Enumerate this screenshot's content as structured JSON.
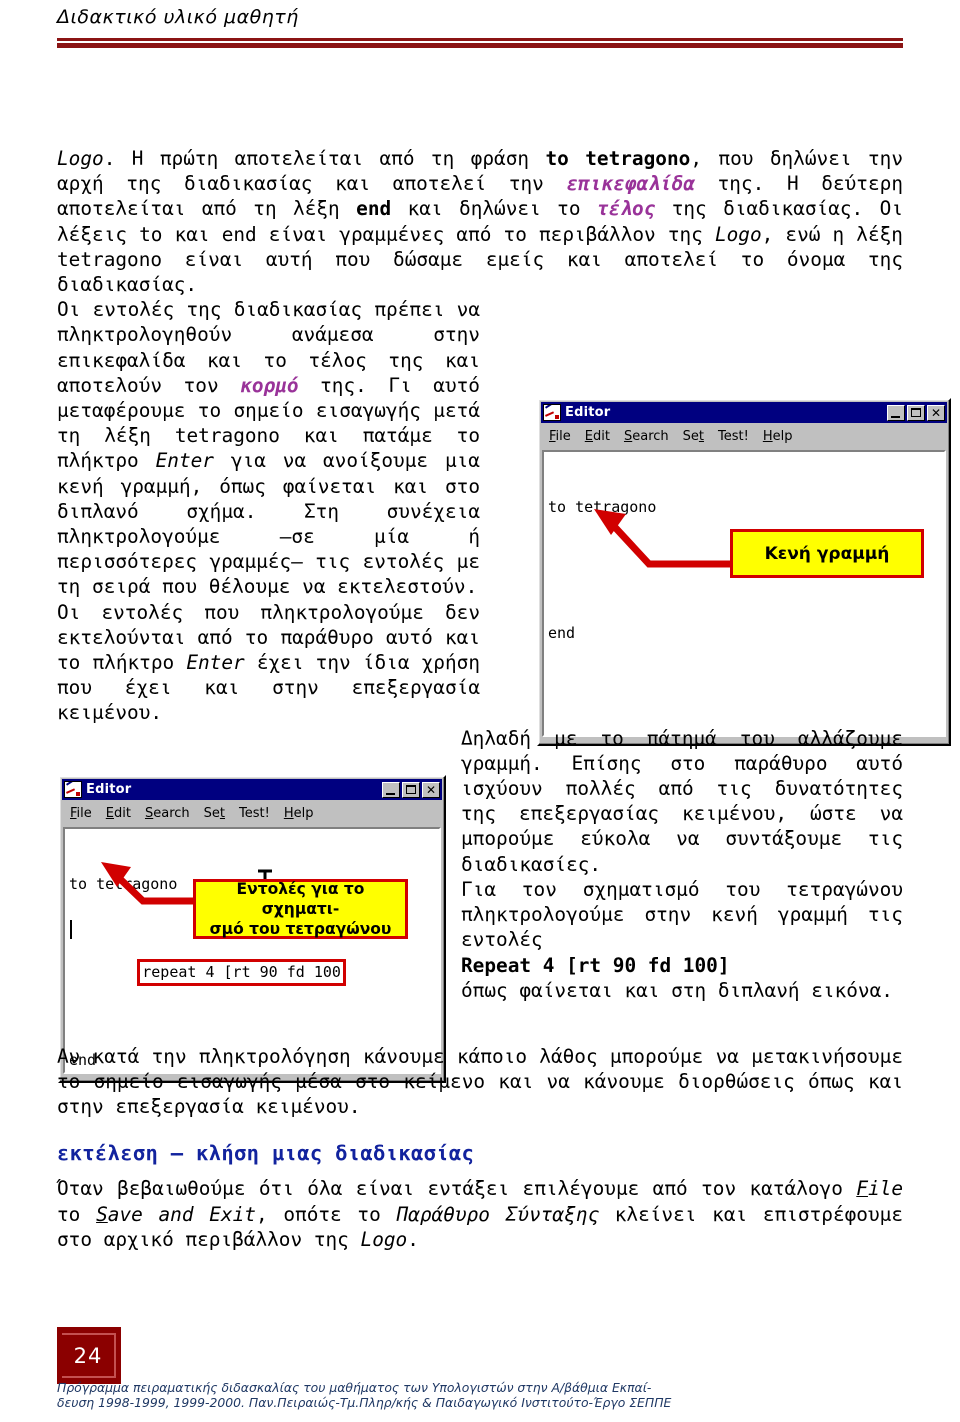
{
  "header": {
    "title": "Διδακτικό υλικό μαθητή"
  },
  "content": {
    "para1": {
      "seg1": "Logo",
      "seg2": ". Η πρώτη αποτελείται από τη φράση ",
      "seg3": "to tetragono",
      "seg4": ", που δηλώνει την αρχή της διαδικασίας και αποτελεί την ",
      "seg5": "επικεφαλίδα",
      "seg6": " της. Η δεύτερη αποτελείται από τη λέξη ",
      "seg7": "end",
      "seg8": " και δηλώνει το ",
      "seg9": "τέλος",
      "seg10": " της διαδικασίας. Οι λέξεις to και end είναι γραμμένες από το περιβάλλον της ",
      "seg11": "Logo",
      "seg12": ", ενώ η λέξη tetragono είναι αυτή που δώσαμε εμείς και αποτελεί το όνομα της διαδικασίας."
    },
    "para2": {
      "seg1": "Οι εντολές της διαδικασίας πρέπει να πληκτρολογηθούν ανάμεσα στην επικεφαλίδα και το τέλος της και αποτελούν τον ",
      "seg2": "κορμό",
      "seg3": " της. Γι αυτό μεταφέρουμε το σημείο εισαγωγής μετά τη λέξη tetragono και πατάμε το πλήκτρο ",
      "seg4": "Enter",
      "seg5": " για να ανοίξουμε μια κενή γραμμή, όπως φαίνεται και στο διπλανό σχήμα. Στη συνέχεια πληκτρολογούμε –σε μία ή περισσότερες γραμμές– τις εντολές με τη σειρά που θέλουμε να εκτελεστούν."
    },
    "para3": {
      "seg1": "Οι εντολές που πληκτρολογούμε δεν εκτελούνται από το παράθυρο αυτό και το πλήκτρο ",
      "seg2": "Enter",
      "seg3": " έχει την ίδια χρήση που έχει και στην επεξεργασία κειμένου."
    },
    "para4": {
      "seg1": "Δηλαδή με το πάτημά του αλλάζουμε γραμμή. Επίσης στο παράθυρο αυτό ισχύουν πολλές από τις δυνατότητες της επεξεργασίας κειμένου, ώστε να μπορούμε εύκολα να συντάξουμε τις διαδικασίες."
    },
    "para5": {
      "seg1": "Για τον σχηματισμό του τετραγώνου πληκτρολογούμε στην κενή γραμμή τις εντολές",
      "code": "Repeat 4 [rt 90 fd 100]",
      "seg2": "όπως φαίνεται και στη διπλανή εικόνα."
    },
    "para6": {
      "seg1": "Αν κατά την πληκτρολόγηση κάνουμε κάποιο λάθος μπορούμε να μετακινήσουμε το σημείο εισαγωγής μέσα στο κείμενο και να κάνουμε διορθώσεις όπως και στην επεξεργασία κειμένου."
    },
    "subheading": "εκτέλεση – κλήση μιας διαδικασίας",
    "para7": {
      "seg1": "Όταν βεβαιωθούμε ότι όλα είναι εντάξει επιλέγουμε από τον κατάλογο ",
      "seg2a": "F",
      "seg2b": "ile",
      "seg3": " το ",
      "seg4a": "S",
      "seg4b": "ave and Exit",
      "seg5": ", οπότε το ",
      "seg6": "Παράθυρο Σύνταξης",
      "seg7": " κλείνει και επιστρέφουμε στο αρχικό περιβάλλον της ",
      "seg8": "Logo",
      "seg9": "."
    }
  },
  "editor_window_1": {
    "title": "Editor",
    "icon": "editor-document-icon",
    "buttons": {
      "minimize": "_",
      "maximize": "□",
      "close": "✕"
    },
    "menu": [
      {
        "accel": "F",
        "rest": "ile"
      },
      {
        "accel": "E",
        "rest": "dit"
      },
      {
        "accel": "S",
        "rest": "earch"
      },
      {
        "accel": "Se",
        "rest": "t"
      },
      {
        "accel": "",
        "rest": "Test!"
      },
      {
        "accel": "H",
        "rest": "elp"
      }
    ],
    "code_lines": [
      "to tetragono",
      "",
      "end"
    ],
    "callout": "Κενή γραμμή"
  },
  "editor_window_2": {
    "title": "Editor",
    "icon": "editor-document-icon",
    "buttons": {
      "minimize": "_",
      "maximize": "□",
      "close": "✕"
    },
    "menu": [
      {
        "accel": "F",
        "rest": "ile"
      },
      {
        "accel": "E",
        "rest": "dit"
      },
      {
        "accel": "S",
        "rest": "earch"
      },
      {
        "accel": "Se",
        "rest": "t"
      },
      {
        "accel": "",
        "rest": "Test!"
      },
      {
        "accel": "H",
        "rest": "elp"
      }
    ],
    "code_line_1": "to tetragono",
    "code_line_2": "repeat 4 [rt 90 fd 100",
    "code_line_3": "end",
    "callout_line_1": "Εντολές για το σχηματι-",
    "callout_line_2": "σμό του τετραγώνου"
  },
  "page_number": "24",
  "footer": {
    "line1": "Πρόγραμμα πειραματικής διδασκαλίας του μαθήματος των Υπολογιστών στην  Α/βάθμια Εκπαί-",
    "line2": "δευση 1998-1999, 1999-2000. Παν.Πειραιώς-Τμ.Πληρ/κής & Παιδαγωγικό Ινστιτούτο-Έργο ΣΕΠΠΕ"
  },
  "colors": {
    "rule": "#8b1414",
    "emphasis": "#993399",
    "heading": "#12239e",
    "callout_bg": "#ffff00",
    "callout_border": "#d10000",
    "titlebar": "#000080",
    "page_box": "#8b0000",
    "footer": "#1f3864"
  }
}
